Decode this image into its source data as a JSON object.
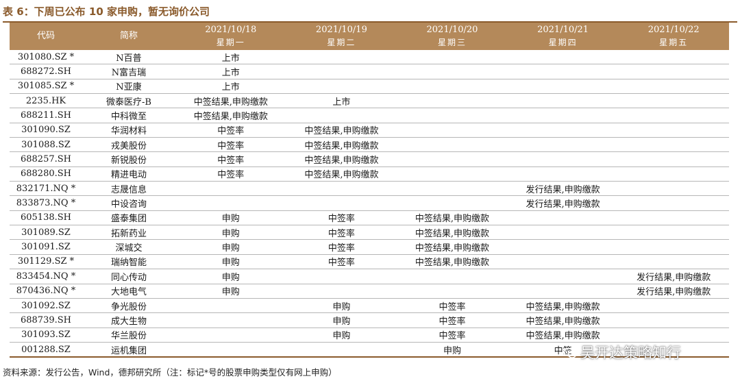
{
  "title": "表 6：下周已公布 10 家申购，暂无询价公司",
  "table": {
    "headers": {
      "code": "代码",
      "name": "简称",
      "days": [
        {
          "date": "2021/10/18",
          "weekday": "星期一"
        },
        {
          "date": "2021/10/19",
          "weekday": "星期二"
        },
        {
          "date": "2021/10/20",
          "weekday": "星期三"
        },
        {
          "date": "2021/10/21",
          "weekday": "星期四"
        },
        {
          "date": "2021/10/22",
          "weekday": "星期五"
        }
      ]
    },
    "rows": [
      {
        "code": "301080.SZ *",
        "name": "N百普",
        "d": [
          "上市",
          "",
          "",
          "",
          ""
        ]
      },
      {
        "code": "688272.SH",
        "name": "N富吉瑞",
        "d": [
          "上市",
          "",
          "",
          "",
          ""
        ]
      },
      {
        "code": "301085.SZ *",
        "name": "N亚康",
        "d": [
          "上市",
          "",
          "",
          "",
          ""
        ]
      },
      {
        "code": "2235.HK",
        "name": "微泰医疗-B",
        "d": [
          "中签结果,申购缴款",
          "上市",
          "",
          "",
          ""
        ]
      },
      {
        "code": "688211.SH",
        "name": "中科微至",
        "d": [
          "中签结果,申购缴款",
          "",
          "",
          "",
          ""
        ]
      },
      {
        "code": "301090.SZ",
        "name": "华润材料",
        "d": [
          "中签率",
          "中签结果,申购缴款",
          "",
          "",
          ""
        ]
      },
      {
        "code": "301088.SZ",
        "name": "戎美股份",
        "d": [
          "中签率",
          "中签结果,申购缴款",
          "",
          "",
          ""
        ]
      },
      {
        "code": "688257.SH",
        "name": "新锐股份",
        "d": [
          "中签率",
          "中签结果,申购缴款",
          "",
          "",
          ""
        ]
      },
      {
        "code": "688280.SH",
        "name": "精进电动",
        "d": [
          "中签率",
          "中签结果,申购缴款",
          "",
          "",
          ""
        ]
      },
      {
        "code": "832171.NQ *",
        "name": "志晟信息",
        "d": [
          "",
          "",
          "",
          "发行结果,申购缴款",
          ""
        ]
      },
      {
        "code": "833873.NQ *",
        "name": "中设咨询",
        "d": [
          "",
          "",
          "",
          "发行结果,申购缴款",
          ""
        ]
      },
      {
        "code": "605138.SH",
        "name": "盛泰集团",
        "d": [
          "申购",
          "中签率",
          "中签结果,申购缴款",
          "",
          ""
        ]
      },
      {
        "code": "301089.SZ",
        "name": "拓新药业",
        "d": [
          "申购",
          "中签率",
          "中签结果,申购缴款",
          "",
          ""
        ]
      },
      {
        "code": "301091.SZ",
        "name": "深城交",
        "d": [
          "申购",
          "中签率",
          "中签结果,申购缴款",
          "",
          ""
        ]
      },
      {
        "code": "301129.SZ *",
        "name": "瑞纳智能",
        "d": [
          "申购",
          "中签率",
          "中签结果,申购缴款",
          "",
          ""
        ]
      },
      {
        "code": "833454.NQ *",
        "name": "同心传动",
        "d": [
          "申购",
          "",
          "",
          "",
          "发行结果,申购缴款"
        ]
      },
      {
        "code": "870436.NQ *",
        "name": "大地电气",
        "d": [
          "申购",
          "",
          "",
          "",
          "发行结果,申购缴款"
        ]
      },
      {
        "code": "301092.SZ",
        "name": "争光股份",
        "d": [
          "",
          "申购",
          "中签率",
          "中签结果,申购缴款",
          ""
        ]
      },
      {
        "code": "688739.SH",
        "name": "成大生物",
        "d": [
          "",
          "申购",
          "中签率",
          "中签结果,申购缴款",
          ""
        ]
      },
      {
        "code": "301093.SZ",
        "name": "华兰股份",
        "d": [
          "",
          "申购",
          "中签率",
          "中签结果,申购缴款",
          ""
        ]
      },
      {
        "code": "001288.SZ",
        "name": "运机集团",
        "d": [
          "",
          "",
          "申购",
          "中签",
          ""
        ]
      }
    ]
  },
  "source": "资料来源：发行公告，Wind，德邦研究所（注：标记*号的股票申购类型仅有网上申购）",
  "watermark": "吴开达策略知行",
  "colors": {
    "accent": "#8a5a2b",
    "header_bg": "#b4895a",
    "row_rule": "#b6b6b6"
  }
}
